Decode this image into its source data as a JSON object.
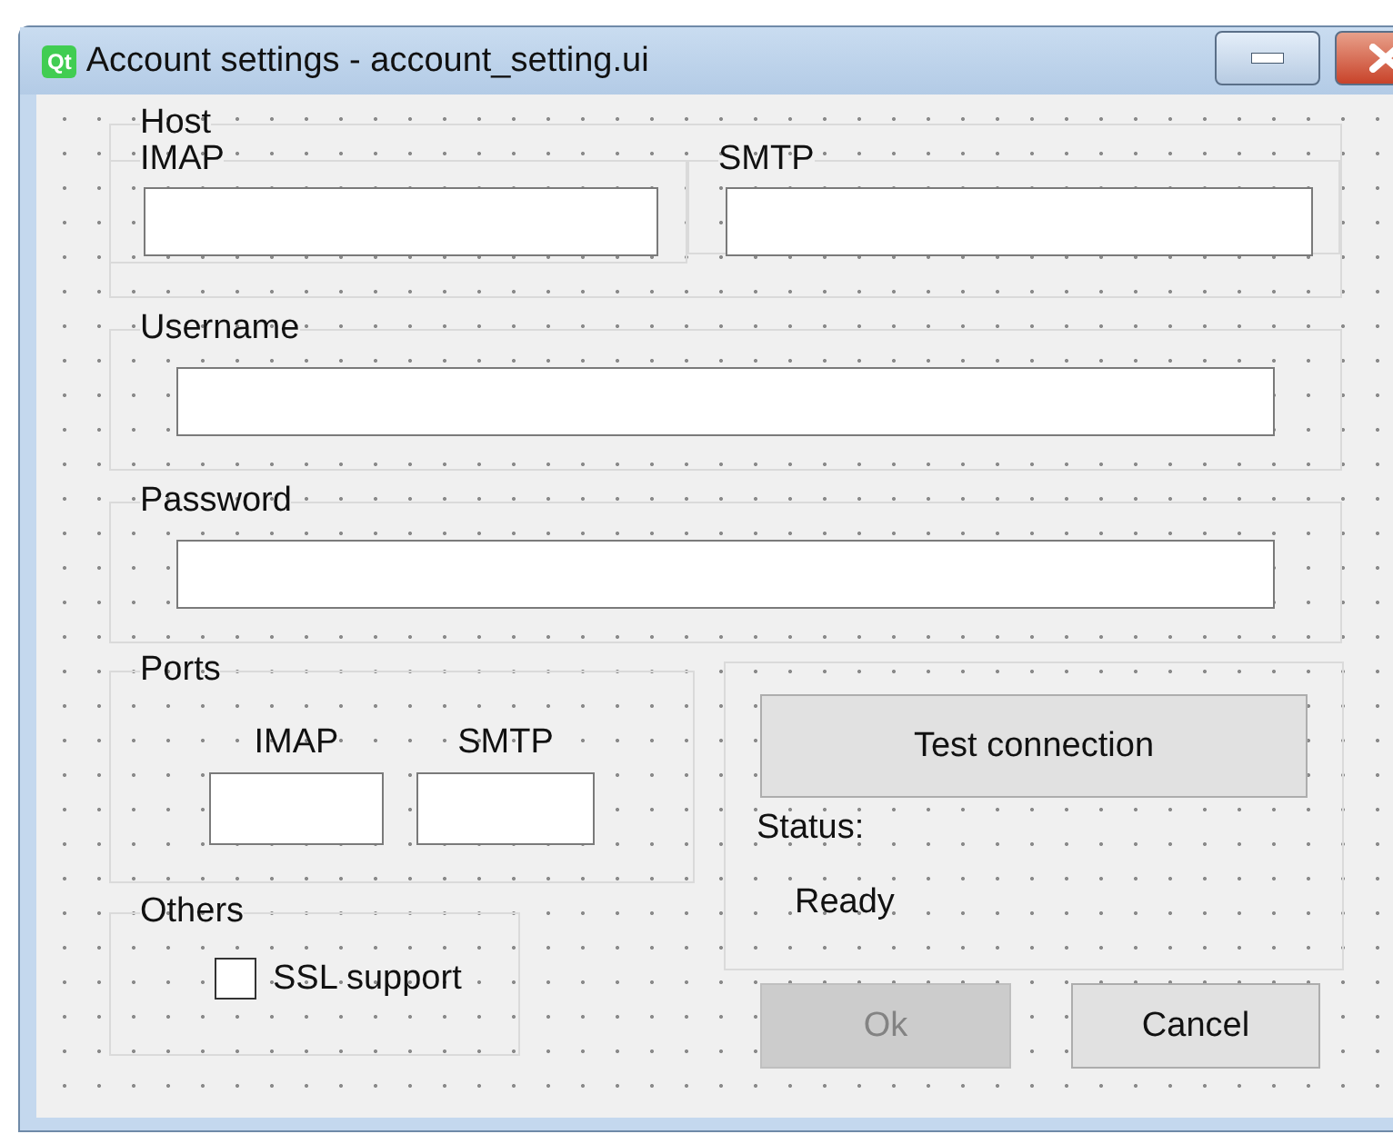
{
  "window": {
    "logo_text": "Qt",
    "title": "Account settings - account_setting.ui"
  },
  "host": {
    "title": "Host",
    "groups": [
      {
        "title": "IMAP"
      },
      {
        "title": "SMTP"
      }
    ]
  },
  "username": {
    "title": "Username"
  },
  "password": {
    "title": "Password"
  },
  "ports": {
    "title": "Ports",
    "fields": [
      {
        "label": "IMAP"
      },
      {
        "label": "SMTP"
      }
    ]
  },
  "test_button": {
    "label": "Test connection"
  },
  "status": {
    "label": "Status:",
    "value": "Ready"
  },
  "others": {
    "title": "Others",
    "checkbox": {
      "label": "SSL support",
      "checked": false
    }
  },
  "buttons": [
    {
      "label": "Ok",
      "disabled": true
    },
    {
      "label": "Cancel",
      "disabled": false
    }
  ]
}
